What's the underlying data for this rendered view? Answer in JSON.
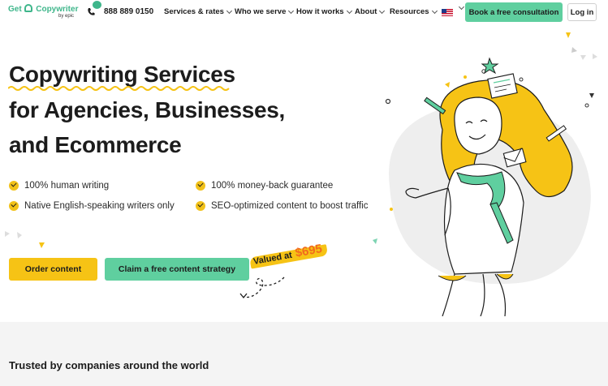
{
  "nav": {
    "logo": {
      "name": "Get Copywriter",
      "prefix": "Get",
      "suffix": "Copywriter",
      "by": "by epic"
    },
    "phone": "888 889 0150",
    "menu": [
      {
        "label": "Services & rates"
      },
      {
        "label": "Who we serve"
      },
      {
        "label": "How it works"
      },
      {
        "label": "About"
      },
      {
        "label": "Resources"
      }
    ],
    "language": "us-flag-icon",
    "consult_button": "Book a free consultation",
    "login_button": "Log in"
  },
  "hero": {
    "headline": [
      "Copywriting Services",
      "for Agencies, Businesses,",
      "and Ecommerce"
    ],
    "features": [
      "100% human writing",
      "100% money-back guarantee",
      "Native English-speaking writers only",
      "SEO-optimized content to boost traffic"
    ],
    "order_button": "Order content",
    "claim_button": "Claim a free content strategy",
    "valued_label": "Valued at",
    "valued_price": "$695"
  },
  "trusted": {
    "title": "Trusted by companies around the world"
  },
  "colors": {
    "brand_green": "#5fcf9f",
    "brand_yellow": "#f6c315",
    "price_orange": "#f26b1d",
    "logo_green": "#3fb68b"
  }
}
